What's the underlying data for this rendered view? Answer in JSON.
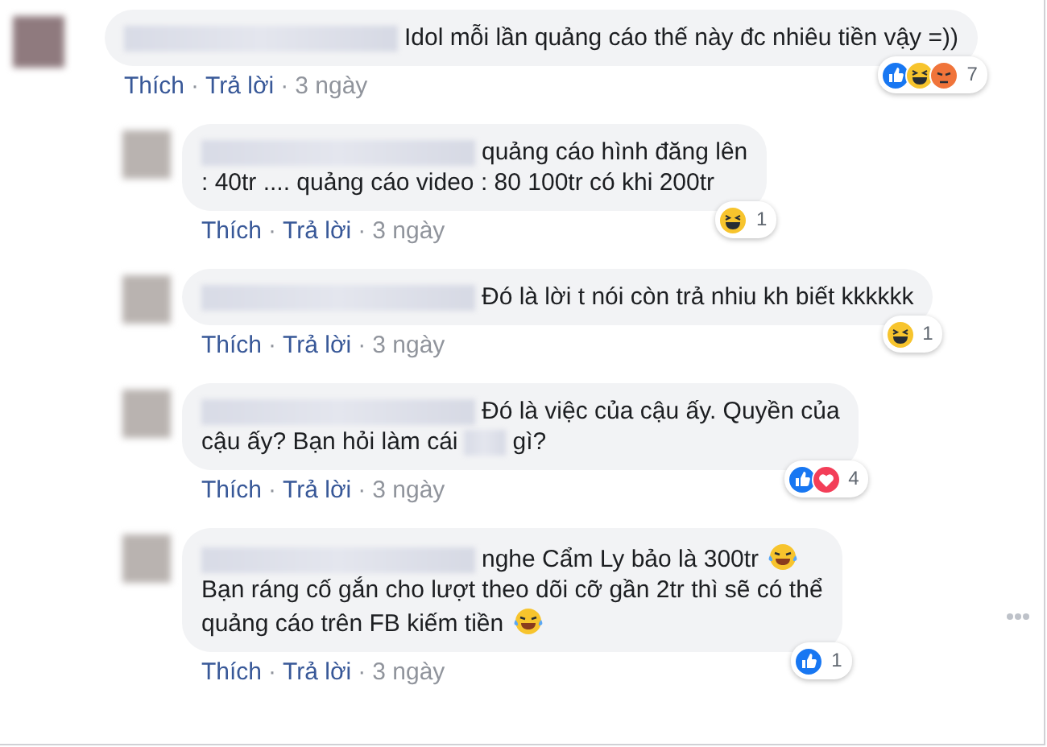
{
  "separator": "·",
  "comments": [
    {
      "reply": false,
      "more_menu": false,
      "parts": [
        {
          "kind": "blur_name"
        },
        {
          "kind": "text",
          "text": "Idol mỗi lần quảng cáo thế này đc nhiêu tiền vậy =))"
        }
      ],
      "reactions": [
        {
          "kind": "like"
        },
        {
          "kind": "haha"
        },
        {
          "kind": "angry"
        }
      ],
      "reaction_count": "7",
      "like_label": "Thích",
      "reply_label": "Trả lời",
      "time": "3 ngày"
    },
    {
      "reply": true,
      "more_menu": false,
      "parts": [
        {
          "kind": "blur_name"
        },
        {
          "kind": "text",
          "text": "quảng cáo hình đăng lên"
        },
        {
          "kind": "break"
        },
        {
          "kind": "text",
          "text": ": 40tr .... quảng cáo video : 80 100tr có khi 200tr"
        }
      ],
      "reactions": [
        {
          "kind": "haha"
        }
      ],
      "reaction_count": "1",
      "like_label": "Thích",
      "reply_label": "Trả lời",
      "time": "3 ngày"
    },
    {
      "reply": true,
      "more_menu": false,
      "parts": [
        {
          "kind": "blur_name"
        },
        {
          "kind": "text",
          "text": "Đó là lời t nói còn trả nhiu kh biết kkkkkk"
        }
      ],
      "reactions": [
        {
          "kind": "haha"
        }
      ],
      "reaction_count": "1",
      "like_label": "Thích",
      "reply_label": "Trả lời",
      "time": "3 ngày"
    },
    {
      "reply": true,
      "more_menu": false,
      "parts": [
        {
          "kind": "blur_name"
        },
        {
          "kind": "text",
          "text": "Đó là việc của cậu ấy. Quyền của"
        },
        {
          "kind": "break"
        },
        {
          "kind": "text",
          "text": "cậu ấy? Bạn hỏi làm cái"
        },
        {
          "kind": "blur_word"
        },
        {
          "kind": "text",
          "text": "gì?"
        }
      ],
      "reactions": [
        {
          "kind": "like"
        },
        {
          "kind": "love"
        }
      ],
      "reaction_count": "4",
      "like_label": "Thích",
      "reply_label": "Trả lời",
      "time": "3 ngày"
    },
    {
      "reply": true,
      "more_menu": true,
      "parts": [
        {
          "kind": "blur_name"
        },
        {
          "kind": "text",
          "text": "nghe Cẩm Ly bảo là 300tr"
        },
        {
          "kind": "emoji"
        },
        {
          "kind": "break"
        },
        {
          "kind": "text",
          "text": "Bạn ráng cố gắn cho lượt theo dõi cỡ gần 2tr thì sẽ có thể"
        },
        {
          "kind": "break"
        },
        {
          "kind": "text",
          "text": "quảng cáo trên FB kiếm tiền"
        },
        {
          "kind": "emoji"
        }
      ],
      "reactions": [
        {
          "kind": "like"
        }
      ],
      "reaction_count": "1",
      "like_label": "Thích",
      "reply_label": "Trả lời",
      "time": "3 ngày"
    }
  ]
}
